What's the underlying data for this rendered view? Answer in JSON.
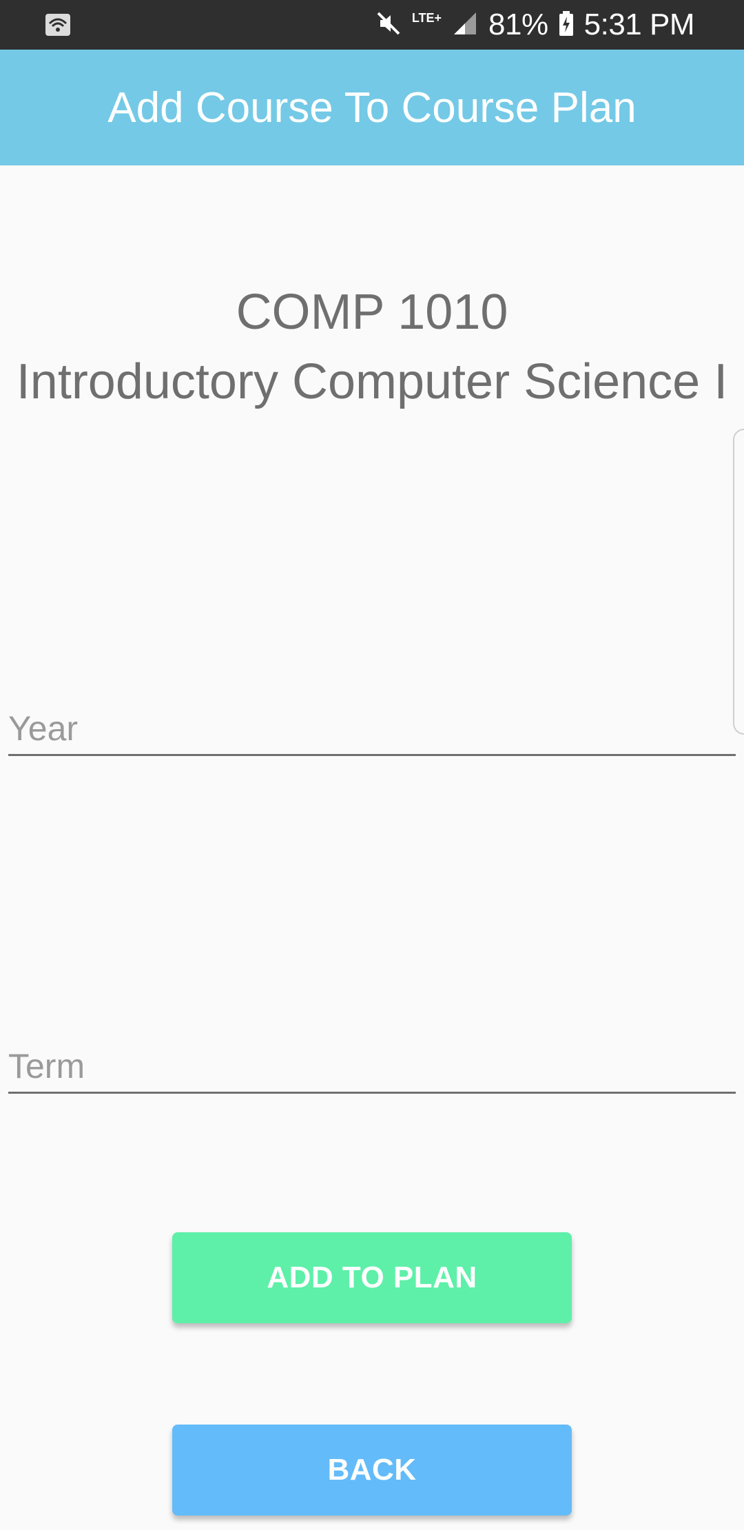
{
  "status_bar": {
    "wifi_icon": "wifi-icon",
    "mute_icon": "mute-icon",
    "network_label": "LTE+",
    "signal_icon": "signal-icon",
    "battery_percent": "81%",
    "battery_icon": "battery-charging-icon",
    "time": "5:31 PM"
  },
  "app_bar": {
    "title": "Add Course To Course Plan"
  },
  "course": {
    "code": "COMP 1010",
    "name": "Introductory Computer Science I"
  },
  "form": {
    "year": {
      "value": "",
      "placeholder": "Year"
    },
    "term": {
      "value": "",
      "placeholder": "Term"
    }
  },
  "buttons": {
    "add_label": "ADD TO PLAN",
    "back_label": "BACK"
  },
  "colors": {
    "status_bar_bg": "#2f2f2f",
    "app_bar_bg": "#74cae6",
    "add_button": "#5ef0a8",
    "back_button": "#63bcf9",
    "text_gray": "#6f6f6f"
  }
}
